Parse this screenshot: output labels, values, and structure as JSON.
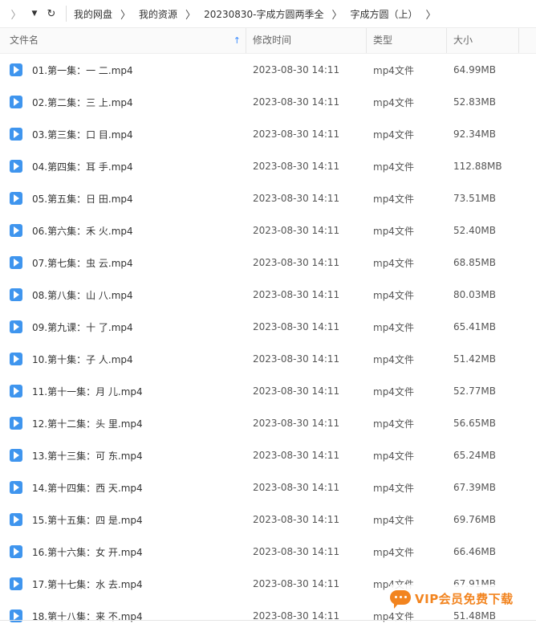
{
  "nav": {
    "back_glyph": "〉",
    "dropdown_glyph": "▼",
    "refresh_glyph": "↻"
  },
  "breadcrumb": [
    "我的网盘",
    "我的资源",
    "20230830-字成方圆两季全",
    "字成方圆（上）"
  ],
  "breadcrumb_sep": "〉",
  "columns": {
    "name": "文件名",
    "modified": "修改时间",
    "type": "类型",
    "size": "大小",
    "sort_glyph": "↑"
  },
  "rows": [
    {
      "name": "01.第一集：一 二.mp4",
      "modified": "2023-08-30 14:11",
      "type": "mp4文件",
      "size": "64.99MB"
    },
    {
      "name": "02.第二集：三 上.mp4",
      "modified": "2023-08-30 14:11",
      "type": "mp4文件",
      "size": "52.83MB"
    },
    {
      "name": "03.第三集：口 目.mp4",
      "modified": "2023-08-30 14:11",
      "type": "mp4文件",
      "size": "92.34MB"
    },
    {
      "name": "04.第四集：耳 手.mp4",
      "modified": "2023-08-30 14:11",
      "type": "mp4文件",
      "size": "112.88MB"
    },
    {
      "name": "05.第五集：日 田.mp4",
      "modified": "2023-08-30 14:11",
      "type": "mp4文件",
      "size": "73.51MB"
    },
    {
      "name": "06.第六集：禾 火.mp4",
      "modified": "2023-08-30 14:11",
      "type": "mp4文件",
      "size": "52.40MB"
    },
    {
      "name": "07.第七集：虫 云.mp4",
      "modified": "2023-08-30 14:11",
      "type": "mp4文件",
      "size": "68.85MB"
    },
    {
      "name": "08.第八集：山 八.mp4",
      "modified": "2023-08-30 14:11",
      "type": "mp4文件",
      "size": "80.03MB"
    },
    {
      "name": "09.第九课：十 了.mp4",
      "modified": "2023-08-30 14:11",
      "type": "mp4文件",
      "size": "65.41MB"
    },
    {
      "name": "10.第十集：子 人.mp4",
      "modified": "2023-08-30 14:11",
      "type": "mp4文件",
      "size": "51.42MB"
    },
    {
      "name": "11.第十一集：月 儿.mp4",
      "modified": "2023-08-30 14:11",
      "type": "mp4文件",
      "size": "52.77MB"
    },
    {
      "name": "12.第十二集：头 里.mp4",
      "modified": "2023-08-30 14:11",
      "type": "mp4文件",
      "size": "56.65MB"
    },
    {
      "name": "13.第十三集：可 东.mp4",
      "modified": "2023-08-30 14:11",
      "type": "mp4文件",
      "size": "65.24MB"
    },
    {
      "name": "14.第十四集：西 天.mp4",
      "modified": "2023-08-30 14:11",
      "type": "mp4文件",
      "size": "67.39MB"
    },
    {
      "name": "15.第十五集：四 是.mp4",
      "modified": "2023-08-30 14:11",
      "type": "mp4文件",
      "size": "69.76MB"
    },
    {
      "name": "16.第十六集：女 开.mp4",
      "modified": "2023-08-30 14:11",
      "type": "mp4文件",
      "size": "66.46MB"
    },
    {
      "name": "17.第十七集：水 去.mp4",
      "modified": "2023-08-30 14:11",
      "type": "mp4文件",
      "size": "67.91MB"
    },
    {
      "name": "18.第十八集：来 不.mp4",
      "modified": "2023-08-30 14:11",
      "type": "mp4文件",
      "size": "51.48MB"
    }
  ],
  "watermark": {
    "text": "VIP会员免费下载",
    "color": "#f2841f"
  },
  "colors": {
    "accent": "#3b8cff",
    "file_icon": "#3f95ee"
  }
}
